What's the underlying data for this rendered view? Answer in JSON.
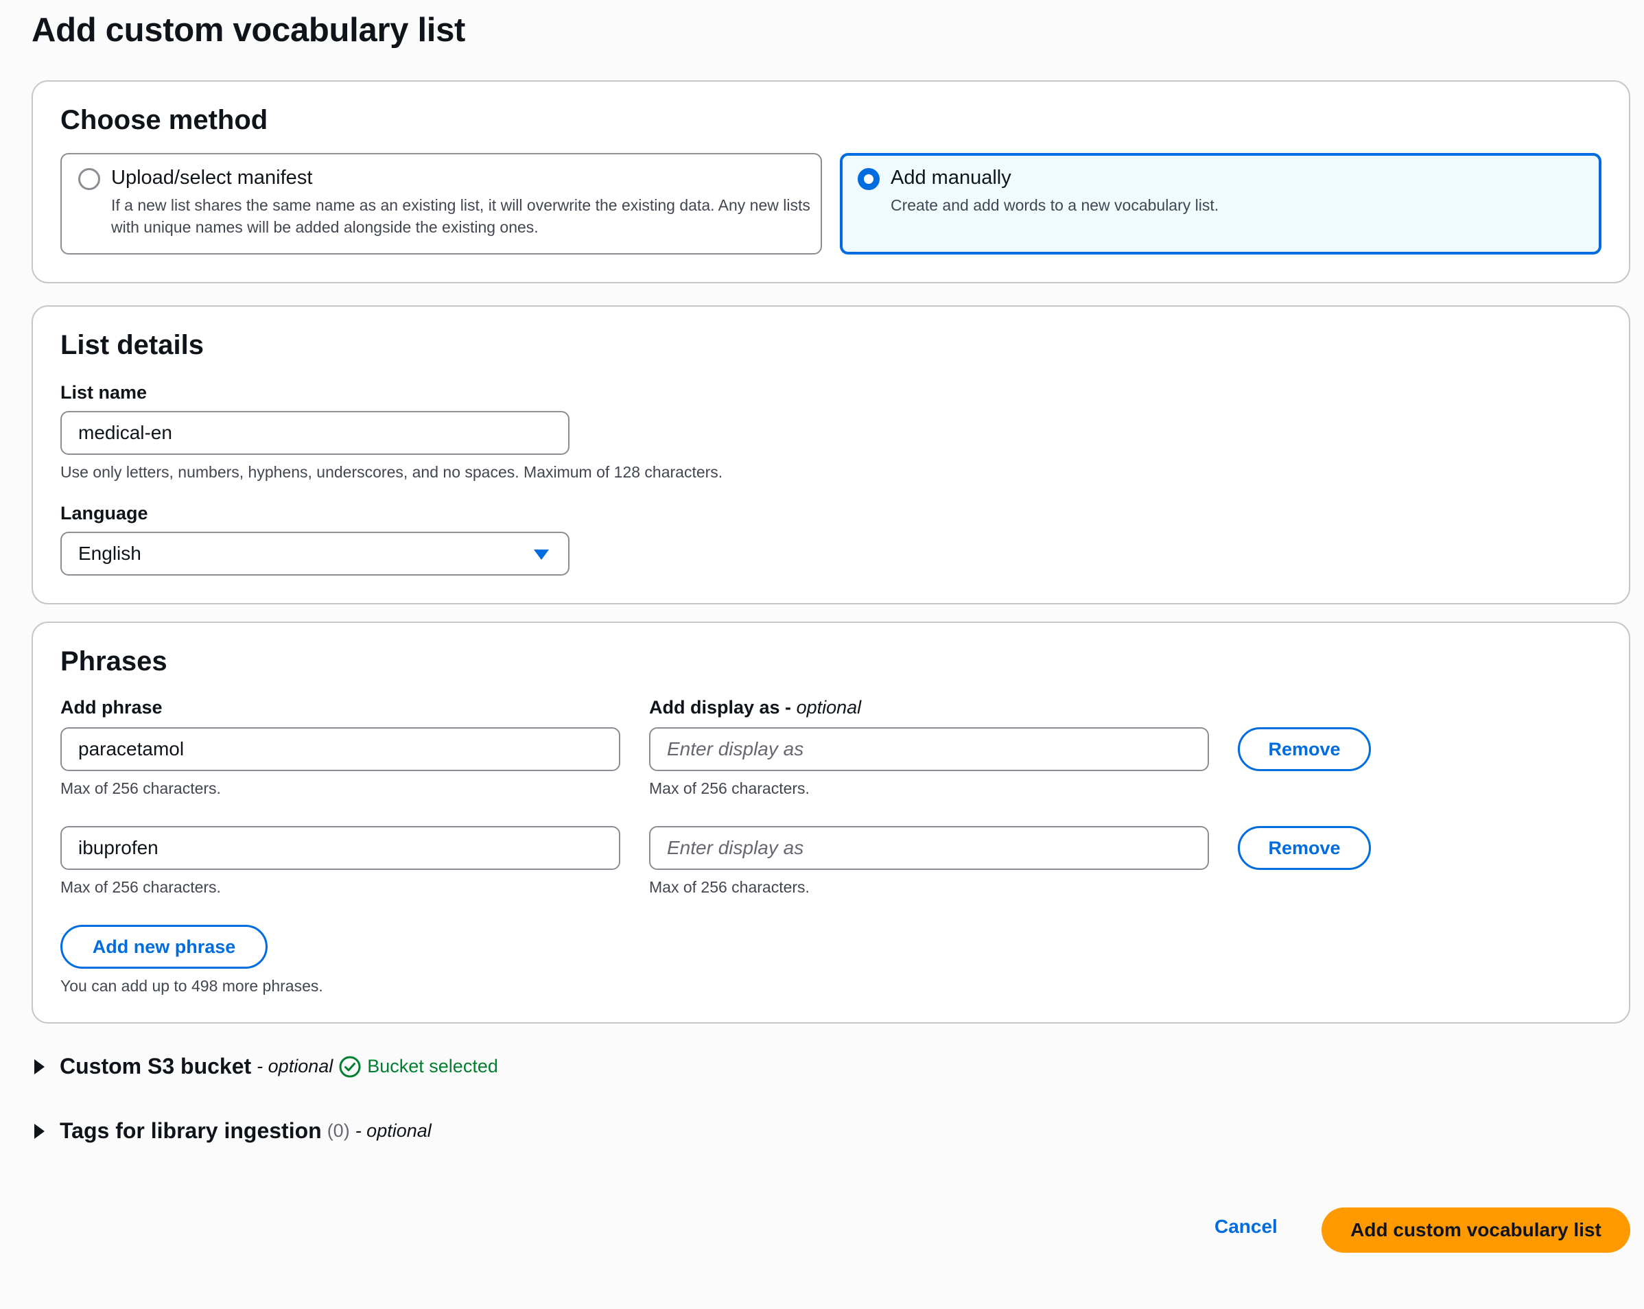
{
  "page": {
    "title": "Add custom vocabulary list"
  },
  "choose_method": {
    "title": "Choose method",
    "options": [
      {
        "label": "Upload/select manifest",
        "description": "If a new list shares the same name as an existing list, it will overwrite the existing data. Any new lists with unique names will be added alongside the existing ones.",
        "selected": false
      },
      {
        "label": "Add manually",
        "description": "Create and add words to a new vocabulary list.",
        "selected": true
      }
    ]
  },
  "list_details": {
    "title": "List details",
    "name_label": "List name",
    "name_value": "medical-en",
    "name_hint": "Use only letters, numbers, hyphens, underscores, and no spaces. Maximum of 128 characters.",
    "language_label": "Language",
    "language_value": "English"
  },
  "phrases": {
    "title": "Phrases",
    "phrase_label": "Add phrase",
    "display_label": "Add display as - ",
    "display_optional": "optional",
    "display_placeholder": "Enter display as",
    "max_hint": "Max of 256 characters.",
    "remove_label": "Remove",
    "rows": [
      {
        "phrase": "paracetamol",
        "display_as": ""
      },
      {
        "phrase": "ibuprofen",
        "display_as": ""
      }
    ],
    "add_button": "Add new phrase",
    "remaining_hint": "You can add up to 498 more phrases."
  },
  "s3_bucket": {
    "title": "Custom S3 bucket",
    "optional": "- optional",
    "status": "Bucket selected"
  },
  "tags": {
    "title": "Tags for library ingestion",
    "count": "(0)",
    "optional": "- optional"
  },
  "footer": {
    "cancel": "Cancel",
    "submit": "Add custom vocabulary list"
  },
  "colors": {
    "accent": "#006ce0",
    "primary_button": "#ff9900",
    "success": "#00802f",
    "selected_bg": "#f0fbff"
  }
}
